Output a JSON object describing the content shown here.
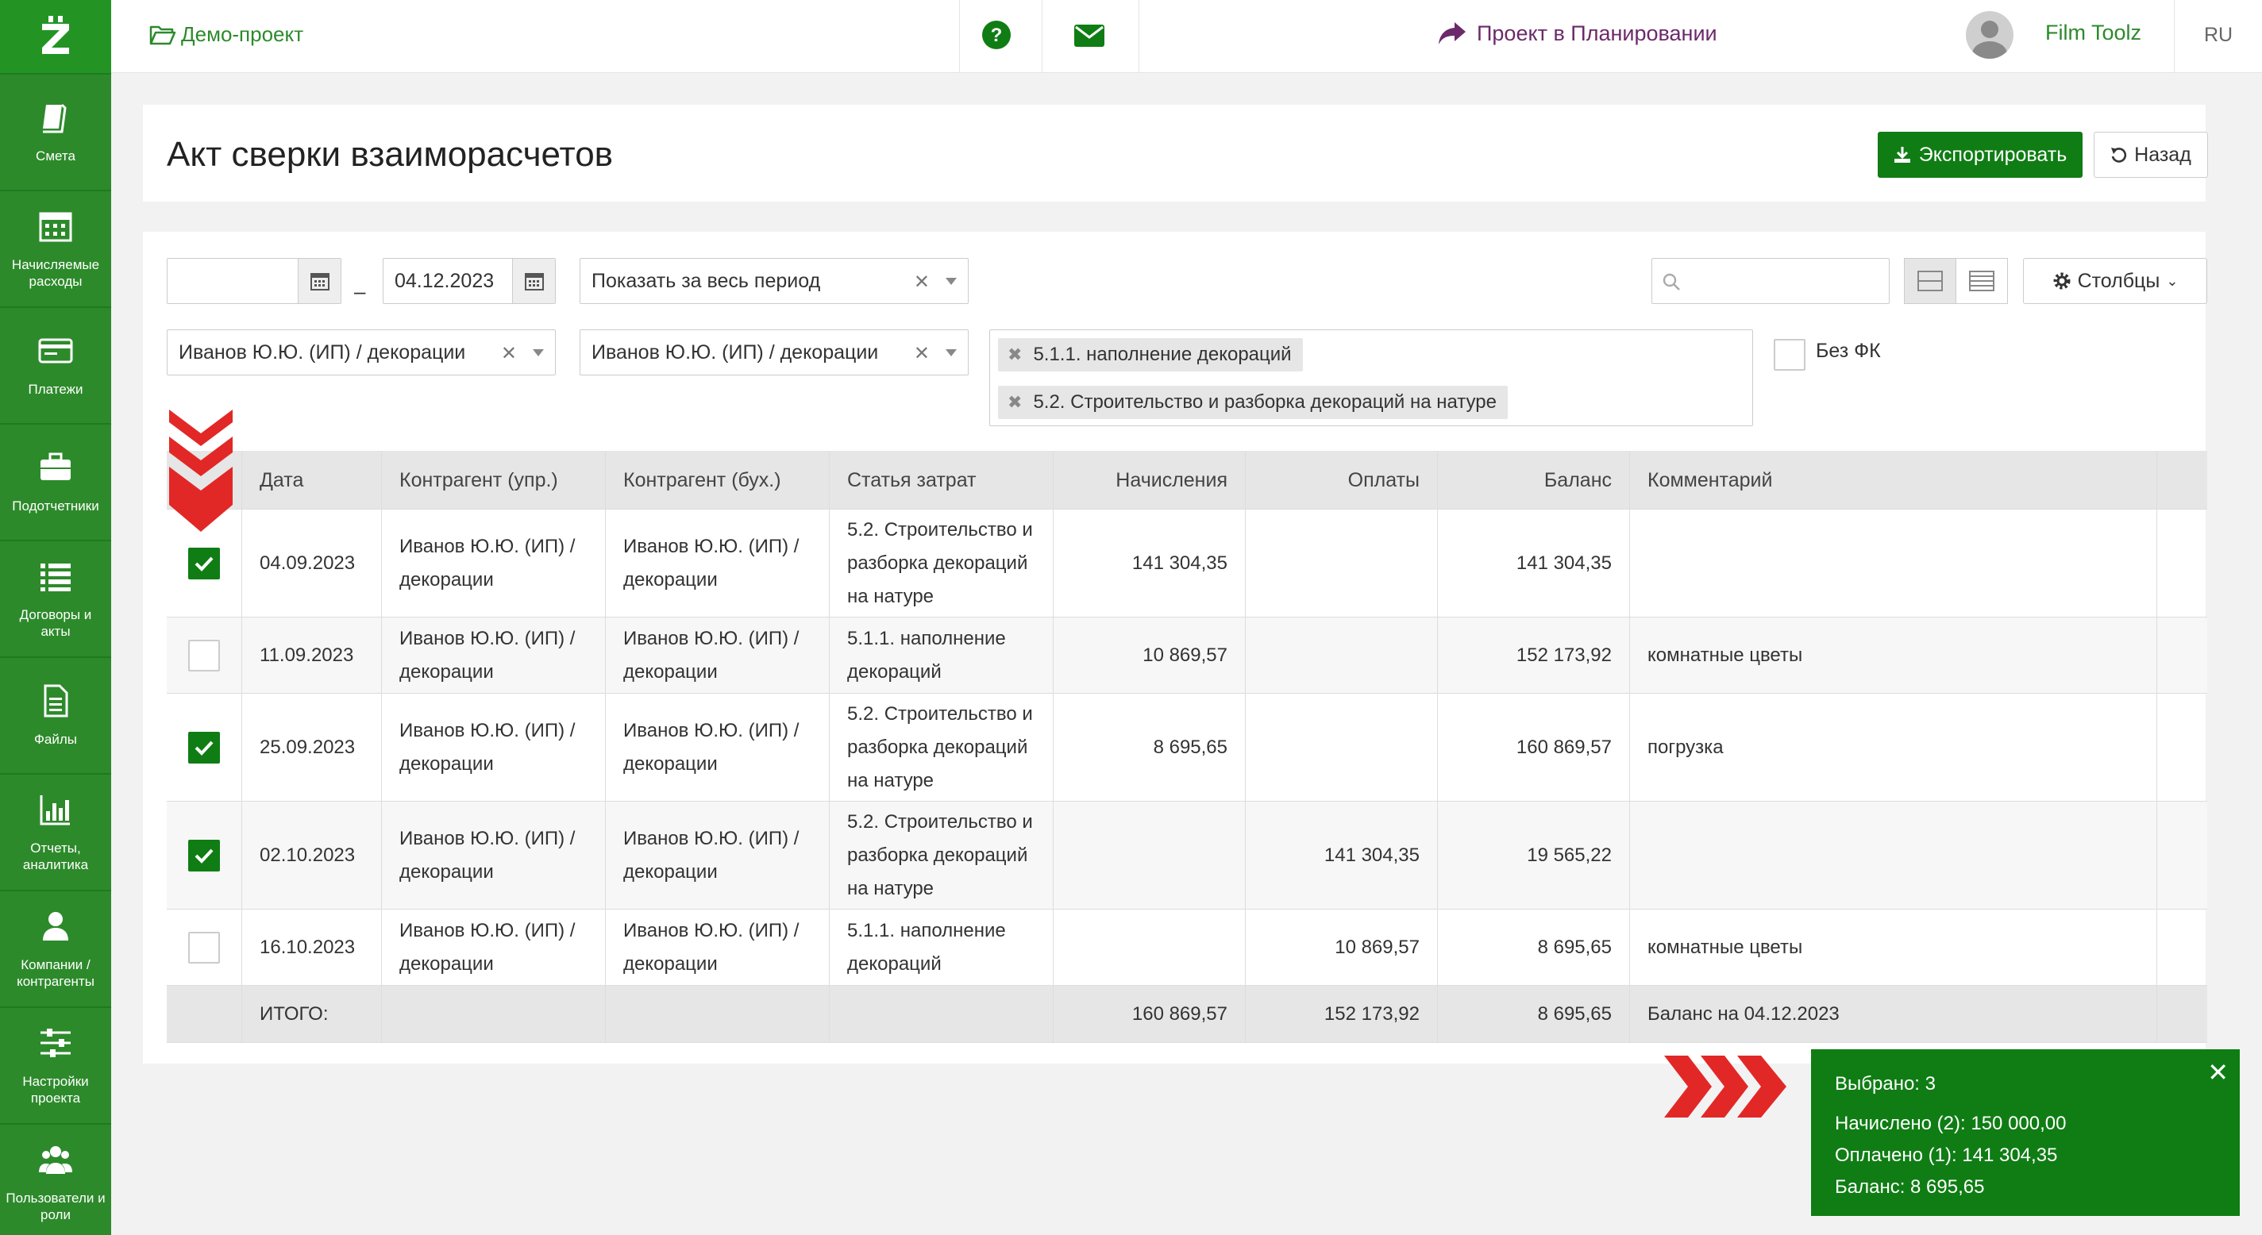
{
  "sidebar": {
    "items": [
      {
        "label": "Смета",
        "icon": "book-icon"
      },
      {
        "label": "Начисляемые расходы",
        "icon": "calendar-icon"
      },
      {
        "label": "Платежи",
        "icon": "payments-icon"
      },
      {
        "label": "Подотчетники",
        "icon": "briefcase-icon"
      },
      {
        "label": "Договоры и акты",
        "icon": "list-icon"
      },
      {
        "label": "Файлы",
        "icon": "file-icon"
      },
      {
        "label": "Отчеты, аналитика",
        "icon": "chart-icon"
      },
      {
        "label": "Компании / контрагенты",
        "icon": "user-icon"
      },
      {
        "label": "Настройки проекта",
        "icon": "sliders-icon"
      },
      {
        "label": "Пользователи и роли",
        "icon": "users-icon"
      }
    ]
  },
  "header": {
    "project": "Демо-проект",
    "status": "Проект в Планировании",
    "user": "Film Toolz",
    "lang": "RU"
  },
  "page": {
    "title": "Акт сверки взаиморасчетов",
    "export_label": "Экспортировать",
    "back_label": "Назад"
  },
  "filters": {
    "date_from": "",
    "date_to": "04.12.2023",
    "period": "Показать за весь период",
    "contractor_mgmt": "Иванов Ю.Ю. (ИП) / декорации",
    "contractor_acc": "Иванов Ю.Ю. (ИП) / декорации",
    "cost_items": [
      "5.1.1. наполнение декораций",
      "5.2. Строительство и разборка декораций на натуре"
    ],
    "no_fk_label": "Без ФК",
    "search_value": "",
    "columns_label": "Столбцы"
  },
  "table": {
    "headers": [
      "Дата",
      "Контрагент (упр.)",
      "Контрагент (бух.)",
      "Статья затрат",
      "Начисления",
      "Оплаты",
      "Баланс",
      "Комментарий"
    ],
    "rows": [
      {
        "checked": true,
        "date": "04.09.2023",
        "cmgmt": [
          "Иванов Ю.Ю. (ИП) /",
          "декорации"
        ],
        "cacc": [
          "Иванов Ю.Ю. (ИП) /",
          "декорации"
        ],
        "item": [
          "5.2. Строительство и",
          "разборка декораций",
          "на натуре"
        ],
        "accrued": "141 304,35",
        "paid": "",
        "balance": "141 304,35",
        "comment": ""
      },
      {
        "checked": false,
        "date": "11.09.2023",
        "cmgmt": [
          "Иванов Ю.Ю. (ИП) /",
          "декорации"
        ],
        "cacc": [
          "Иванов Ю.Ю. (ИП) /",
          "декорации"
        ],
        "item": [
          "5.1.1. наполнение",
          "декораций"
        ],
        "accrued": "10 869,57",
        "paid": "",
        "balance": "152 173,92",
        "comment": "комнатные цветы"
      },
      {
        "checked": true,
        "date": "25.09.2023",
        "cmgmt": [
          "Иванов Ю.Ю. (ИП) /",
          "декорации"
        ],
        "cacc": [
          "Иванов Ю.Ю. (ИП) /",
          "декорации"
        ],
        "item": [
          "5.2. Строительство и",
          "разборка декораций",
          "на натуре"
        ],
        "accrued": "8 695,65",
        "paid": "",
        "balance": "160 869,57",
        "comment": "погрузка"
      },
      {
        "checked": true,
        "date": "02.10.2023",
        "cmgmt": [
          "Иванов Ю.Ю. (ИП) /",
          "декорации"
        ],
        "cacc": [
          "Иванов Ю.Ю. (ИП) /",
          "декорации"
        ],
        "item": [
          "5.2. Строительство и",
          "разборка декораций",
          "на натуре"
        ],
        "accrued": "",
        "paid": "141 304,35",
        "balance": "19 565,22",
        "comment": ""
      },
      {
        "checked": false,
        "date": "16.10.2023",
        "cmgmt": [
          "Иванов Ю.Ю. (ИП) /",
          "декорации"
        ],
        "cacc": [
          "Иванов Ю.Ю. (ИП) /",
          "декорации"
        ],
        "item": [
          "5.1.1. наполнение",
          "декораций"
        ],
        "accrued": "",
        "paid": "10 869,57",
        "balance": "8 695,65",
        "comment": "комнатные цветы"
      }
    ],
    "total": {
      "label": "ИТОГО:",
      "accrued": "160 869,57",
      "paid": "152 173,92",
      "balance": "8 695,65",
      "comment": "Баланс на 04.12.2023"
    }
  },
  "summary": {
    "selected": "Выбрано: 3",
    "accrued": "Начислено (2): 150 000,00",
    "paid": "Оплачено (1): 141 304,35",
    "balance": "Баланс: 8 695,65"
  },
  "colors": {
    "brand": "#2d8a2b",
    "button": "#0f7d14",
    "arrow": "#e22826",
    "status": "#6c2a6a"
  }
}
